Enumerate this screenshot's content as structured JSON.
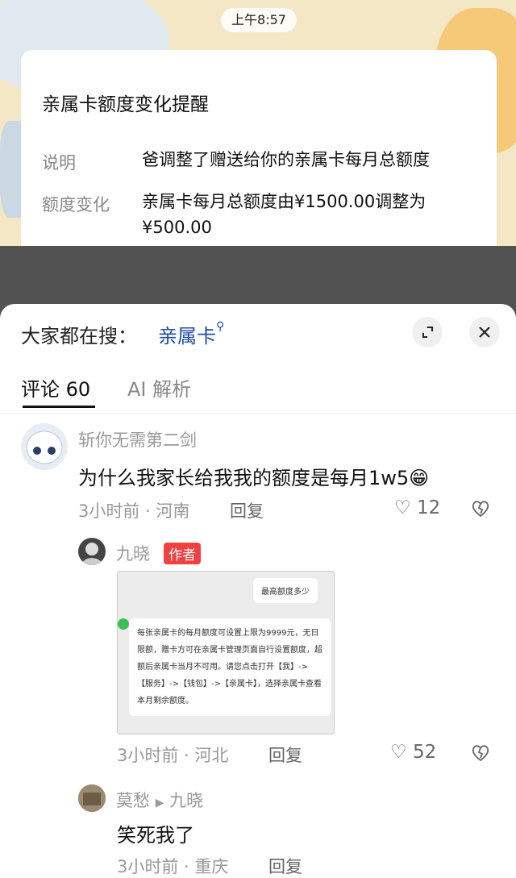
{
  "status_bar": {
    "time": "上午8:57"
  },
  "notification": {
    "title": "亲属卡额度变化提醒",
    "rows": [
      {
        "label": "说明",
        "value": "爸调整了赠送给你的亲属卡每月总额度"
      },
      {
        "label": "额度变化",
        "value": "亲属卡每月总额度由¥1500.00调整为¥500.00"
      }
    ]
  },
  "search_bar": {
    "prefix": "大家都在搜：",
    "term": "亲属卡"
  },
  "tabs": [
    {
      "label": "评论 60",
      "active": true
    },
    {
      "label": "AI 解析",
      "active": false
    }
  ],
  "comments": [
    {
      "user": "斩你无需第二剑",
      "text": "为什么我家长给我我的额度是每月1w5",
      "emoji": "😁",
      "time": "3小时前",
      "location": "河南",
      "reply_label": "回复",
      "likes": "12"
    }
  ],
  "replies": [
    {
      "user": "九晓",
      "badge": "作者",
      "image": {
        "question": "最高额度多少",
        "answer": "每张亲属卡的每月额度可设置上限为9999元，无日限额，赠卡方可在亲属卡管理页面自行设置额度，超额后亲属卡当月不可用。请您点击打开【我】->【服务】->【钱包】->【亲属卡】，选择亲属卡查看本月剩余额度。"
      },
      "time": "3小时前",
      "location": "河北",
      "reply_label": "回复",
      "likes": "52"
    },
    {
      "user": "莫愁",
      "reply_to": "九晓",
      "text": "笑死我了",
      "time": "3小时前",
      "location": "重庆",
      "reply_label": "回复"
    }
  ],
  "colors": {
    "accent_link": "#1d4fa0",
    "author_badge": "#f04040"
  }
}
